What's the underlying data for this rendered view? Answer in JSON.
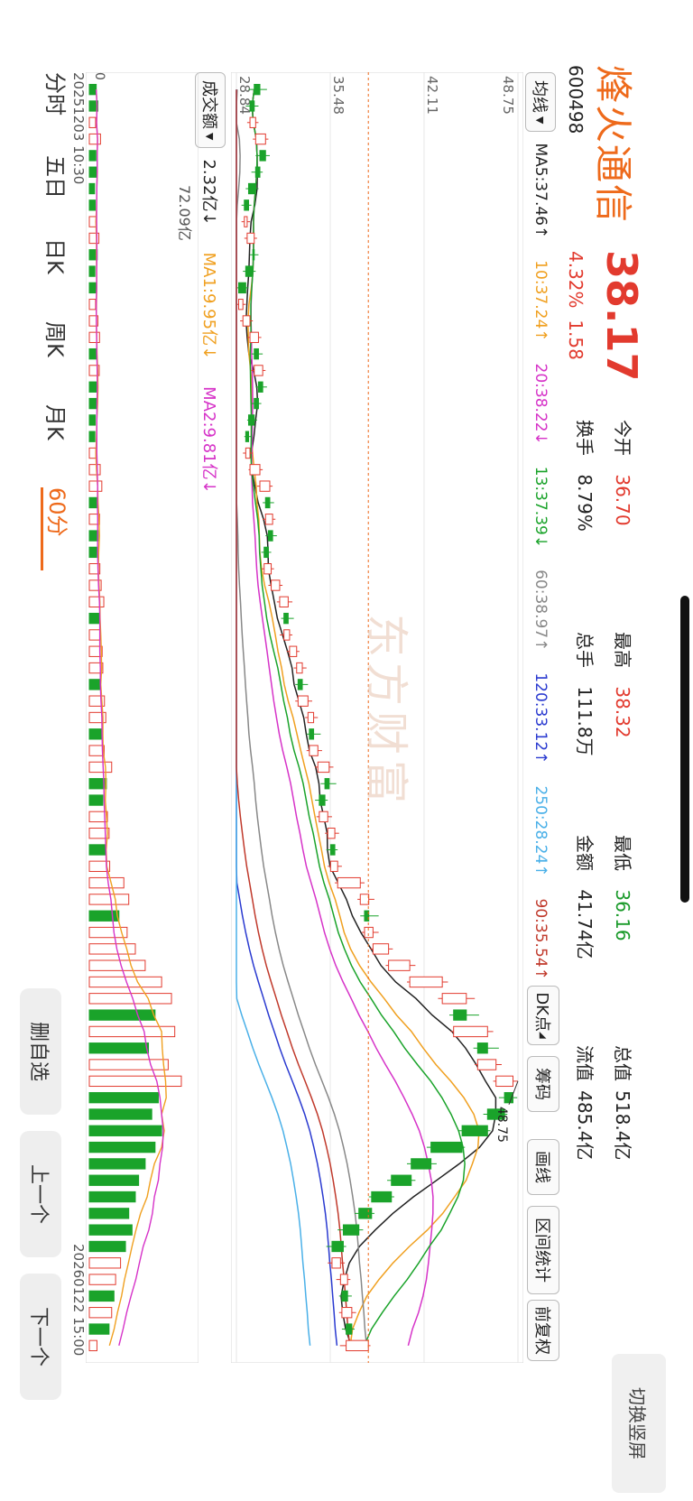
{
  "stock": {
    "name": "烽火通信",
    "price": "38.17",
    "code": "600498",
    "change_pct": "4.32%",
    "change_amt": "1.58"
  },
  "quote": {
    "open_label": "今开",
    "open": "36.70",
    "high_label": "最高",
    "high": "38.32",
    "low_label": "最低",
    "low": "36.16",
    "total_mv_label": "总值",
    "total_mv": "518.4亿",
    "turnover_label": "换手",
    "turnover": "8.79%",
    "volume_label": "总手",
    "volume": "111.8万",
    "amount_label": "金额",
    "amount": "41.74亿",
    "float_mv_label": "流值",
    "float_mv": "485.4亿"
  },
  "switch_button": "切换竖屏",
  "ma_selector": "均线",
  "ma_labels": [
    {
      "text": "MA5:37.46↑",
      "color": "#222222"
    },
    {
      "text": "10:37.24↑",
      "color": "#f0a020"
    },
    {
      "text": "20:38.22↓",
      "color": "#d633c8"
    },
    {
      "text": "13:37.39↓",
      "color": "#1aa32a"
    },
    {
      "text": "60:38.97↑",
      "color": "#888888"
    },
    {
      "text": "120:33.12↑",
      "color": "#2a3ad0"
    },
    {
      "text": "250:28.24↑",
      "color": "#4ab0e8"
    },
    {
      "text": "90:35.54↑",
      "color": "#c0392b"
    }
  ],
  "tools": {
    "dk": "DK点",
    "chip": "筹码",
    "draw": "画线",
    "range_stats": "区间统计",
    "adjust": "前复权"
  },
  "price_axis": {
    "labels": [
      "48.75",
      "42.11",
      "35.48",
      "28.84"
    ]
  },
  "marker_label": "48.75",
  "volume": {
    "selector": "成交额",
    "value": "2.32亿↓",
    "ma1": "MA1:9.95亿↓",
    "ma2": "MA2:9.81亿↓",
    "max_label": "72.09亿",
    "zero": "0"
  },
  "time_axis": {
    "start": "20251203 10:30",
    "end": "20260122 15:00"
  },
  "bottom_tabs": [
    "分时",
    "五日",
    "日K",
    "周K",
    "月K",
    "60分"
  ],
  "active_tab": "60分",
  "actions": {
    "delete": "删自选",
    "prev": "上一个",
    "next": "下一个"
  },
  "watermark": "东方财富",
  "colors": {
    "up": "#e23a2e",
    "down": "#1aa32a",
    "brand": "#ee6a1b"
  },
  "chart_data": {
    "type": "candlestick",
    "price_range": [
      28.84,
      48.75
    ],
    "candles": [
      [
        30.5,
        30.1,
        31.0,
        29.7
      ],
      [
        30.1,
        29.8,
        30.4,
        29.5
      ],
      [
        29.8,
        30.2,
        30.4,
        29.6
      ],
      [
        30.2,
        30.9,
        31.1,
        30.0
      ],
      [
        30.9,
        30.5,
        31.2,
        30.2
      ],
      [
        30.5,
        30.2,
        30.7,
        29.9
      ],
      [
        30.2,
        29.7,
        30.4,
        29.5
      ],
      [
        29.7,
        29.4,
        29.9,
        29.2
      ],
      [
        29.4,
        29.6,
        29.8,
        29.2
      ],
      [
        29.6,
        30.1,
        30.3,
        29.4
      ],
      [
        30.1,
        30.0,
        30.4,
        29.8
      ],
      [
        30.0,
        29.5,
        30.2,
        29.3
      ],
      [
        29.5,
        29.0,
        29.7,
        28.9
      ],
      [
        29.0,
        29.3,
        29.5,
        28.9
      ],
      [
        29.3,
        29.8,
        30.0,
        29.1
      ],
      [
        29.8,
        30.4,
        30.6,
        29.6
      ],
      [
        30.4,
        30.1,
        30.7,
        29.9
      ],
      [
        30.1,
        30.7,
        30.9,
        29.9
      ],
      [
        30.7,
        30.4,
        31.0,
        30.2
      ],
      [
        30.4,
        30.1,
        30.6,
        29.9
      ],
      [
        30.1,
        29.7,
        30.3,
        29.6
      ],
      [
        29.7,
        29.5,
        29.9,
        29.4
      ],
      [
        29.5,
        29.8,
        30.0,
        29.3
      ],
      [
        29.8,
        30.5,
        30.7,
        29.7
      ],
      [
        30.5,
        31.2,
        31.4,
        30.3
      ],
      [
        31.2,
        30.9,
        31.5,
        30.7
      ],
      [
        30.9,
        31.4,
        31.6,
        30.7
      ],
      [
        31.4,
        31.1,
        31.7,
        30.9
      ],
      [
        31.1,
        30.8,
        31.3,
        30.6
      ],
      [
        30.8,
        31.3,
        31.5,
        30.6
      ],
      [
        31.3,
        31.9,
        32.1,
        31.1
      ],
      [
        31.9,
        32.5,
        32.8,
        31.7
      ],
      [
        32.5,
        32.2,
        32.9,
        32.0
      ],
      [
        32.2,
        32.6,
        32.8,
        31.9
      ],
      [
        32.6,
        33.1,
        33.3,
        32.4
      ],
      [
        33.1,
        33.5,
        33.8,
        32.9
      ],
      [
        33.5,
        33.2,
        33.9,
        33.0
      ],
      [
        33.2,
        33.9,
        34.2,
        33.0
      ],
      [
        33.9,
        34.3,
        34.6,
        33.7
      ],
      [
        34.3,
        34.0,
        34.8,
        33.8
      ],
      [
        34.0,
        34.6,
        34.9,
        33.8
      ],
      [
        34.6,
        35.4,
        35.7,
        34.4
      ],
      [
        35.4,
        35.1,
        35.9,
        34.8
      ],
      [
        35.1,
        34.7,
        35.3,
        34.4
      ],
      [
        34.7,
        35.3,
        35.6,
        34.5
      ],
      [
        35.3,
        35.8,
        36.1,
        35.1
      ],
      [
        35.8,
        35.5,
        36.0,
        35.2
      ],
      [
        35.5,
        36.0,
        36.3,
        35.3
      ],
      [
        36.0,
        37.6,
        37.9,
        35.8
      ],
      [
        37.6,
        38.2,
        38.6,
        37.4
      ],
      [
        38.2,
        37.9,
        38.9,
        37.6
      ],
      [
        37.9,
        38.5,
        38.9,
        37.7
      ],
      [
        38.5,
        39.6,
        39.9,
        38.3
      ],
      [
        39.6,
        41.1,
        41.5,
        39.4
      ],
      [
        41.1,
        43.4,
        43.8,
        40.9
      ],
      [
        43.4,
        45.1,
        45.7,
        43.1
      ],
      [
        45.1,
        44.2,
        46.0,
        43.9
      ],
      [
        44.2,
        46.6,
        47.0,
        44.0
      ],
      [
        46.6,
        45.9,
        47.4,
        45.6
      ],
      [
        45.9,
        47.2,
        47.6,
        45.7
      ],
      [
        47.2,
        48.4,
        48.75,
        47.0
      ],
      [
        48.4,
        47.8,
        48.7,
        47.4
      ],
      [
        47.8,
        46.6,
        48.0,
        46.3
      ],
      [
        46.6,
        44.8,
        46.8,
        44.5
      ],
      [
        44.8,
        42.6,
        45.0,
        42.3
      ],
      [
        42.6,
        41.2,
        43.0,
        40.9
      ],
      [
        41.2,
        39.8,
        41.5,
        39.5
      ],
      [
        39.8,
        38.4,
        40.0,
        38.2
      ],
      [
        38.4,
        37.5,
        38.6,
        37.2
      ],
      [
        37.5,
        36.4,
        37.8,
        36.0
      ],
      [
        36.4,
        35.6,
        36.6,
        35.2
      ],
      [
        35.6,
        36.2,
        36.5,
        35.3
      ],
      [
        36.2,
        36.7,
        36.9,
        35.9
      ],
      [
        36.7,
        36.3,
        37.0,
        36.1
      ],
      [
        36.3,
        37.0,
        37.3,
        36.1
      ],
      [
        37.0,
        36.6,
        37.2,
        36.3
      ],
      [
        36.6,
        38.17,
        38.32,
        36.16
      ]
    ],
    "volume": [
      2.1,
      2.6,
      1.9,
      3.4,
      2.0,
      2.3,
      1.6,
      1.8,
      2.2,
      2.9,
      2.4,
      1.7,
      2.0,
      1.9,
      2.6,
      3.1,
      2.2,
      3.0,
      2.3,
      2.1,
      1.8,
      1.7,
      2.0,
      3.3,
      3.8,
      2.5,
      3.1,
      2.7,
      2.2,
      3.2,
      3.6,
      4.4,
      3.0,
      3.3,
      3.9,
      4.1,
      3.2,
      4.6,
      5.0,
      3.7,
      4.5,
      6.8,
      5.2,
      4.1,
      5.5,
      6.0,
      4.9,
      6.2,
      10.5,
      12.0,
      9.0,
      11.5,
      14.0,
      17.0,
      22.0,
      25.0,
      20.0,
      26.0,
      18.0,
      24.0,
      28.0,
      21.0,
      19.0,
      22.0,
      20.0,
      17.0,
      15.0,
      14.0,
      12.0,
      13.0,
      11.0,
      9.5,
      8.0,
      7.5,
      6.8,
      6.0,
      2.32
    ],
    "ma_series": [
      {
        "period": 5,
        "color": "#222222"
      },
      {
        "period": 10,
        "color": "#f0a020"
      },
      {
        "period": 20,
        "color": "#d633c8"
      },
      {
        "period": 13,
        "color": "#1aa32a"
      },
      {
        "period": 60,
        "color": "#888888"
      },
      {
        "period": 120,
        "color": "#2a3ad0"
      },
      {
        "period": 250,
        "color": "#4ab0e8"
      },
      {
        "period": 90,
        "color": "#c0392b"
      }
    ],
    "xlabels": [
      "20251203 10:30",
      "20260122 15:00"
    ]
  }
}
